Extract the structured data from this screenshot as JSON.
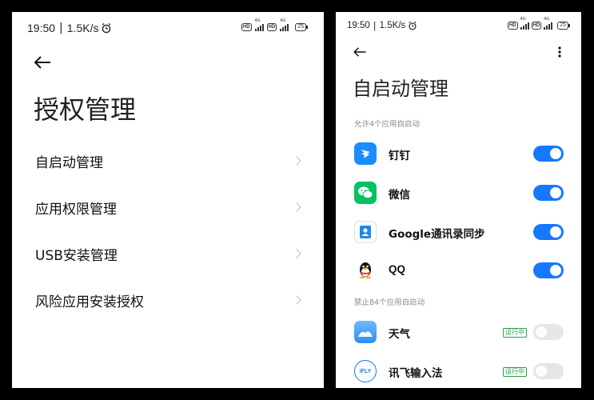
{
  "left_screen": {
    "status": {
      "time": "19:50",
      "speed": "1.5K/s",
      "separator": "|",
      "net1": "HD",
      "gen1": "4G",
      "net2": "HD",
      "gen2": "4G",
      "battery": "25"
    },
    "title": "授权管理",
    "menu_items": [
      {
        "label": "自启动管理"
      },
      {
        "label": "应用权限管理"
      },
      {
        "label": "USB安装管理"
      },
      {
        "label": "风险应用安装授权"
      }
    ]
  },
  "right_screen": {
    "status": {
      "time": "19:50",
      "speed": "1.5K/s",
      "separator": "|",
      "net1": "HD",
      "gen1": "4G",
      "net2": "HD",
      "gen2": "4G",
      "battery": "25"
    },
    "title": "自启动管理",
    "allowed_label": "允许4个应用自启动",
    "allowed_apps": [
      {
        "name": "钉钉",
        "icon": "dingtalk-icon",
        "enabled": true,
        "color": "#1a8cff"
      },
      {
        "name": "微信",
        "icon": "wechat-icon",
        "enabled": true,
        "color": "#07c160"
      },
      {
        "name": "Google通讯录同步",
        "icon": "contacts-sync-icon",
        "enabled": true,
        "color": "#1e88e5"
      },
      {
        "name": "QQ",
        "icon": "qq-icon",
        "enabled": true,
        "color": "#111111"
      }
    ],
    "blocked_label": "禁止84个应用自启动",
    "blocked_apps": [
      {
        "name": "天气",
        "icon": "weather-icon",
        "enabled": false,
        "badge": "运行中",
        "color": "#4aa3f5"
      },
      {
        "name": "讯飞输入法",
        "icon": "iflytek-icon",
        "enabled": false,
        "badge": "运行中",
        "color": "#1a73e8",
        "icon_text": "iFLY"
      }
    ]
  },
  "colors": {
    "accent": "#1677ff",
    "running_badge": "#2e9e4f"
  }
}
